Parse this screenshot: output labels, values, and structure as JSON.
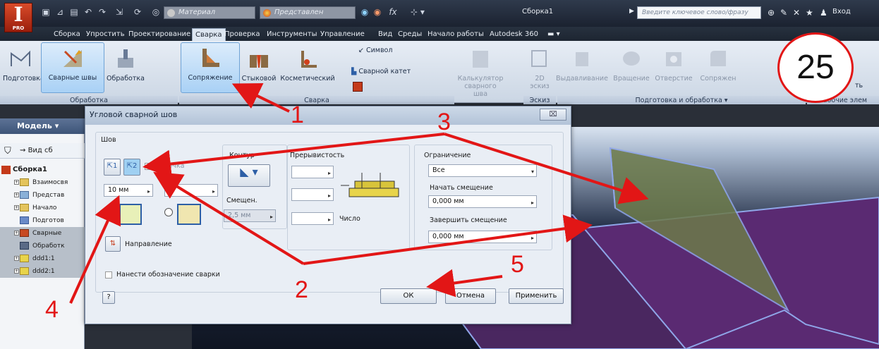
{
  "qat": {
    "material": "Материал",
    "appearance": "Представлен",
    "fx": "fx",
    "title": "Сборка1",
    "search_placeholder": "Введите ключевое слово/фразу",
    "signin": "Вход"
  },
  "app": {
    "letter": "I",
    "edition": "PRO"
  },
  "tabs": [
    "Сборка",
    "Упростить",
    "Проектирование",
    "Сварка",
    "Проверка",
    "Инструменты",
    "Управление",
    "Вид",
    "Среды",
    "Начало работы",
    "Autodesk 360"
  ],
  "ribbon": {
    "prep": "Подготовка",
    "welds": "Сварные швы",
    "machining": "Обработка",
    "fillet": "Сопряжение",
    "groove": "Стыковой",
    "cosmetic": "Косметический",
    "symbol": "Символ",
    "fillet_leg": "Сварной катет",
    "calculator": "Кальку­лятор сварного шва",
    "sketch2d": "2D эскиз",
    "extrude": "Выдавливание",
    "revolve": "Вращение",
    "hole": "Отверстие",
    "fillet2": "Сопряжен",
    "more": "ть",
    "group_prep": "Обработка",
    "group_weld": "Сварка",
    "group_sketch": "Эскиз",
    "group_prep2": "Подготовка и обработка ▾",
    "group_work": "Рабочие элем"
  },
  "browser": {
    "title": "Модель ▾",
    "view": "Вид сб",
    "root": "Сборка1",
    "items": [
      "Взаимосвя",
      "Представ",
      "Начало",
      "Подготов",
      "Сварные",
      "Обработк",
      "ddd1:1",
      "ddd2:1"
    ]
  },
  "dialog": {
    "title": "Угловой сварной шов",
    "close": "⌧",
    "seam": "Шов",
    "chain": "Цепочка",
    "contour": "Контур",
    "offset_label": "Смещен.",
    "offset_value": "2,5 мм",
    "discontinuity": "Прерывистость",
    "number": "Число",
    "size": "10 мм",
    "direction": "Направление",
    "limit": "Ограничение",
    "limit_value": "Все",
    "start_offset": "Начать смещение",
    "start_value": "0,000 мм",
    "end_offset": "Завершить смещение",
    "end_value": "0,000 мм",
    "annotate": "Нанести обозначение сварки",
    "ok": "ОК",
    "cancel": "Отмена",
    "apply": "Применить",
    "help": "?"
  },
  "annotations": {
    "n1": "1",
    "n2": "2",
    "n3": "3",
    "n4": "4",
    "n5": "5",
    "step": "25"
  },
  "colors": {
    "arrow": "#e21616",
    "accent": "#2d5fa6"
  }
}
